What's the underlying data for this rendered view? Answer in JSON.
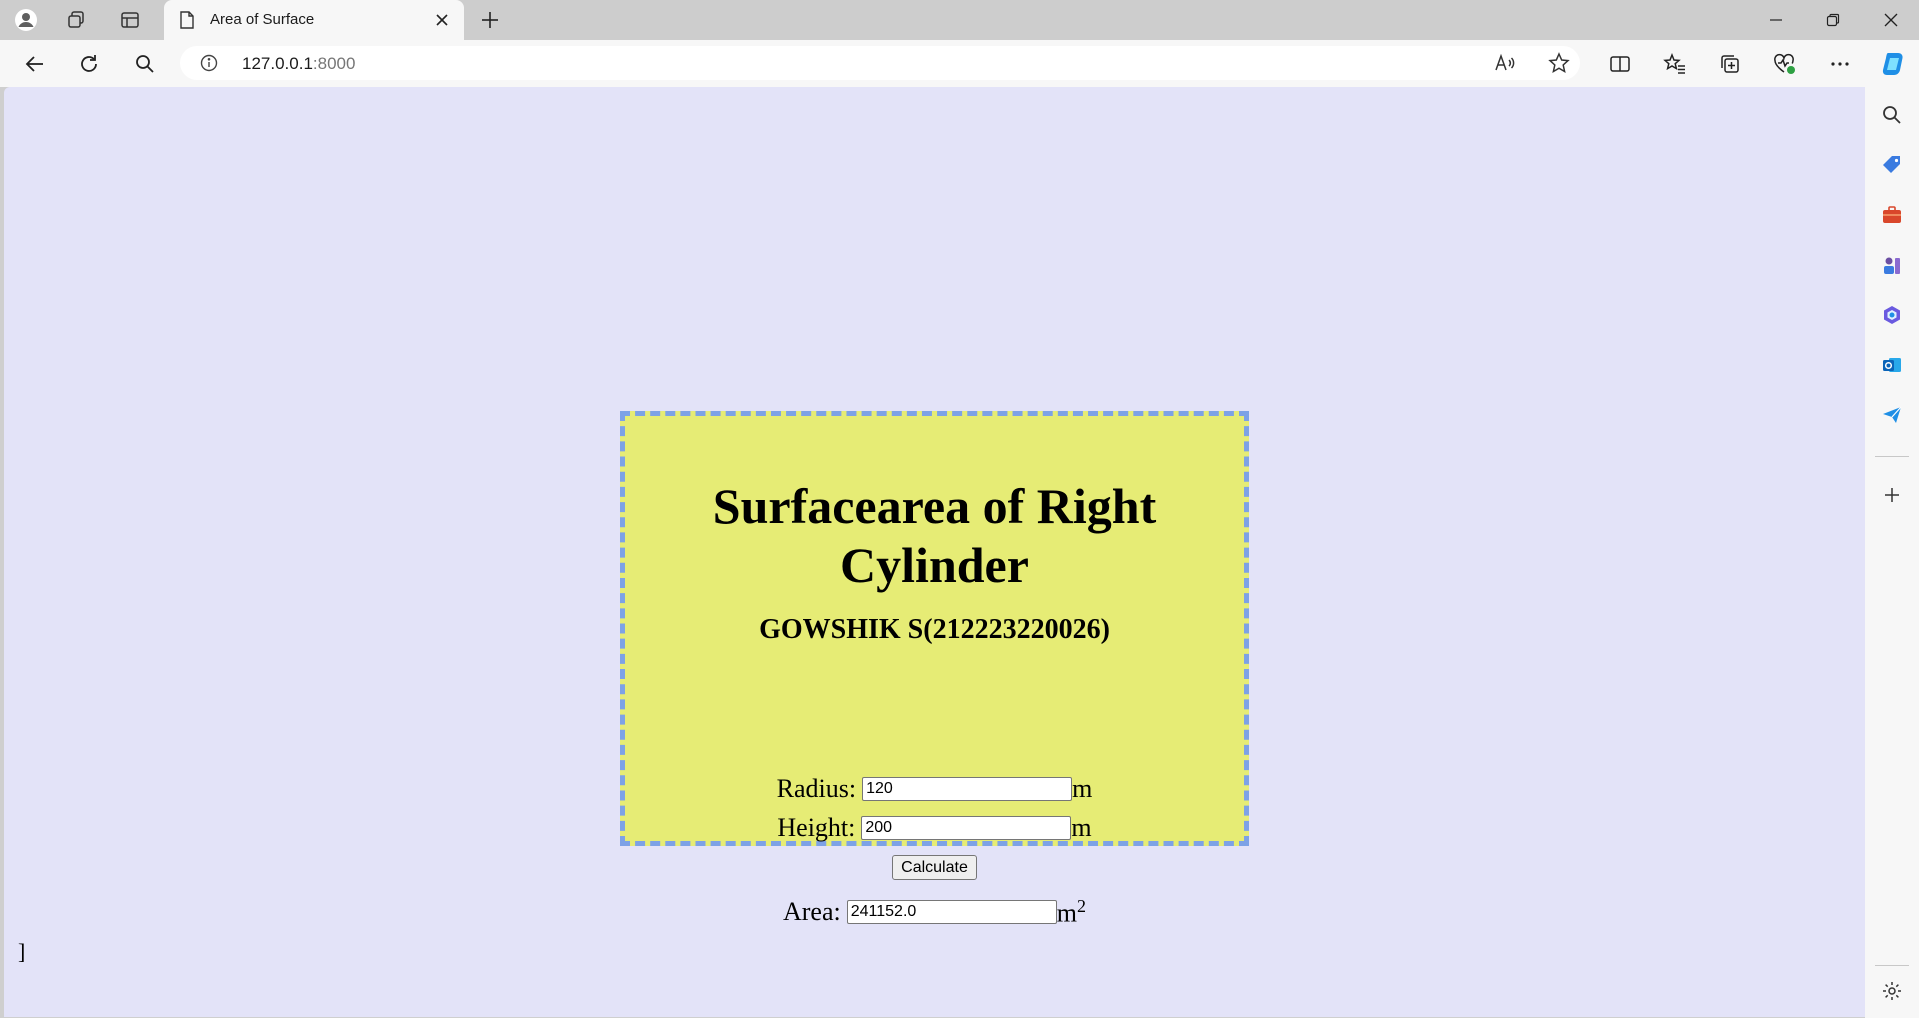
{
  "browser": {
    "tab_title": "Area of Surface",
    "url_host": "127.0.0.1",
    "url_port": ":8000"
  },
  "page": {
    "title": "Surfacearea of Right Cylinder",
    "author": "GOWSHIK S(212223220026)",
    "radius_label": "Radius:",
    "radius_value": "120",
    "radius_unit": "m",
    "height_label": "Height:",
    "height_value": "200",
    "height_unit": "m",
    "calculate_label": "Calculate",
    "area_label": "Area:",
    "area_value": "241152.0",
    "area_unit": "m",
    "area_unit_exp": "2",
    "stray_text": "]"
  },
  "colors": {
    "page_bg": "#e3e3f8",
    "card_bg": "#e6ec75",
    "card_border": "#7da2e6"
  }
}
